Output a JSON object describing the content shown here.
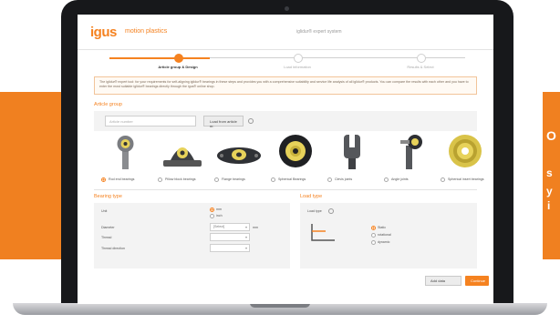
{
  "banner": {
    "color": "#f08020",
    "right_text_lines": [
      "O",
      "s",
      "y",
      "i"
    ]
  },
  "app": {
    "logo_text": "igus",
    "brand_text": "motion plastics",
    "title": "iglidur® expert system",
    "brand_color": "#f58220"
  },
  "steps": [
    {
      "label": "Article group & Design",
      "state": "active"
    },
    {
      "label": "Load information",
      "state": "todo"
    },
    {
      "label": "Results & Select",
      "state": "todo"
    }
  ],
  "info_text": "The iglidur® expert tool: for your requirements for self-aligning iglidur® bearings in these steps and provides you with a comprehensive suitability and service life analysis of all iglidur® products. You can compare the results with each other and you have to enter the most suitable iglidur® bearings directly through the igus® online shop.",
  "article_group": {
    "title": "Article group",
    "search_placeholder": "Article number",
    "load_button": "Load from article nr.",
    "items": [
      {
        "label": "Rod end bearings",
        "icon": "rod-end-bearing-icon",
        "selected": true
      },
      {
        "label": "Pillow block bearings",
        "icon": "pillow-block-bearing-icon",
        "selected": false
      },
      {
        "label": "Flange bearings",
        "icon": "flange-bearing-icon",
        "selected": false
      },
      {
        "label": "Spherical Bearings",
        "icon": "spherical-bearing-icon",
        "selected": false
      },
      {
        "label": "Clevis joints",
        "icon": "clevis-joint-icon",
        "selected": false
      },
      {
        "label": "Angle joints",
        "icon": "angle-joint-icon",
        "selected": false
      },
      {
        "label": "Spherical insert bearings",
        "icon": "spherical-insert-bearing-icon",
        "selected": false
      }
    ]
  },
  "bearing_type": {
    "title": "Bearing type",
    "unit_label": "Unit",
    "unit_options": [
      {
        "label": "mm",
        "selected": true
      },
      {
        "label": "inch",
        "selected": false
      }
    ],
    "diameter_label": "Diameter",
    "diameter_value": "[Select]",
    "diameter_unit": "mm",
    "thread_label": "Thread",
    "thread_direction_label": "Thread direction"
  },
  "load_type": {
    "title": "Load type",
    "load_label": "Load type",
    "options": [
      {
        "label": "Static",
        "selected": true
      },
      {
        "label": "rotational",
        "selected": false
      },
      {
        "label": "dynamic",
        "selected": false
      }
    ]
  },
  "footer": {
    "add_button": "Add data",
    "next_button": "Continue"
  }
}
